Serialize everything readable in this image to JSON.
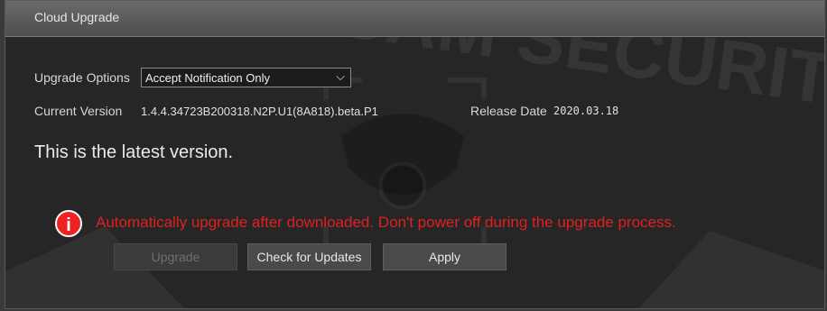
{
  "window": {
    "title": "Cloud Upgrade"
  },
  "upgrade_options": {
    "label": "Upgrade Options",
    "selected": "Accept Notification Only"
  },
  "version": {
    "current_label": "Current Version",
    "current_value": "1.4.4.34723B200318.N2P.U1(8A818).beta.P1",
    "release_label": "Release Date",
    "release_value": "2020.03.18"
  },
  "status": {
    "message": "This is the latest version."
  },
  "warning": {
    "text": "Automatically upgrade after downloaded. Don't power off during the upgrade process.",
    "color": "#e02020",
    "icon": "info-icon"
  },
  "buttons": {
    "upgrade": "Upgrade",
    "check": "Check for Updates",
    "apply": "Apply"
  },
  "watermark": {
    "text": "COLLSAM SECURITY"
  }
}
